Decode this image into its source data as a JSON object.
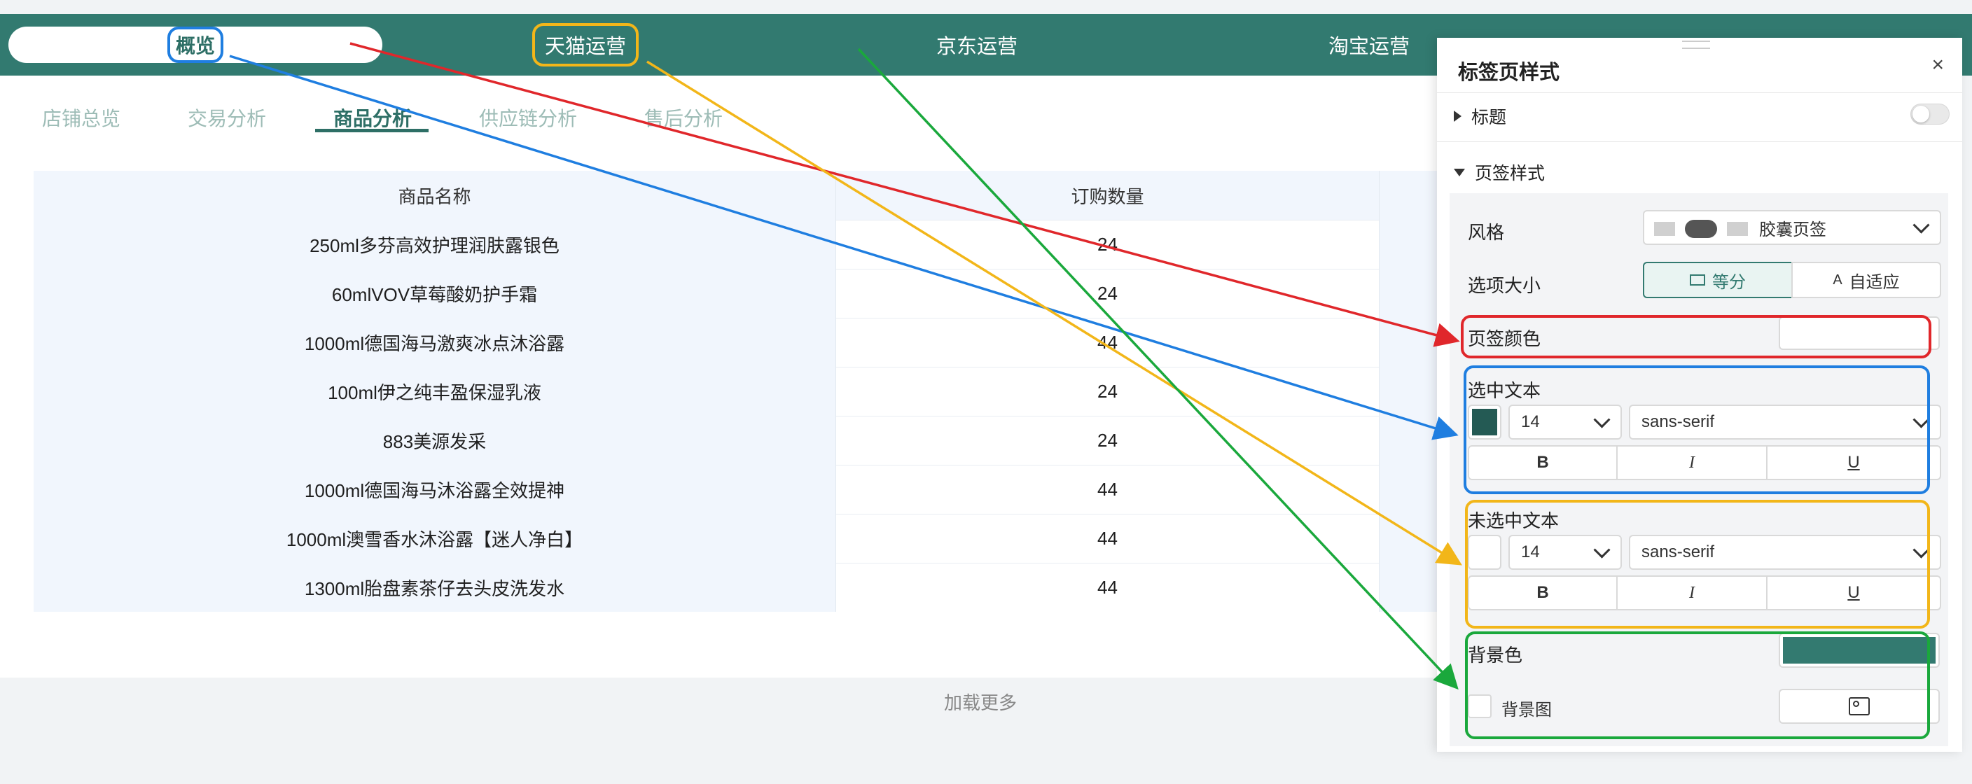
{
  "top_tabs": [
    {
      "label": "概览"
    },
    {
      "label": "天猫运营"
    },
    {
      "label": "京东运营"
    },
    {
      "label": "淘宝运营"
    }
  ],
  "sub_tabs": [
    {
      "label": "店铺总览"
    },
    {
      "label": "交易分析"
    },
    {
      "label": "商品分析"
    },
    {
      "label": "供应链分析"
    },
    {
      "label": "售后分析"
    }
  ],
  "table": {
    "headers": [
      "商品名称",
      "订购数量"
    ],
    "rows": [
      [
        "250ml多芬高效护理润肤露银色",
        "24"
      ],
      [
        "60mlVOV草莓酸奶护手霜",
        "24"
      ],
      [
        "1000ml德国海马激爽冰点沐浴露",
        "44"
      ],
      [
        "100ml伊之纯丰盈保湿乳液",
        "24"
      ],
      [
        "883美源发采",
        "24"
      ],
      [
        "1000ml德国海马沐浴露全效提神",
        "44"
      ],
      [
        "1000ml澳雪香水沐浴露【迷人净白】",
        "44"
      ],
      [
        "1300ml胎盘素茶仔去头皮洗发水",
        "44"
      ]
    ],
    "load_more": "加载更多"
  },
  "panel": {
    "title": "标签页样式",
    "close": "×",
    "title_section": "标题",
    "tab_style_section": "页签样式",
    "style_label": "风格",
    "style_value": "胶囊页签",
    "size_label": "选项大小",
    "size_options": [
      "等分",
      "自适应"
    ],
    "tab_color_label": "页签颜色",
    "selected_text_label": "选中文本",
    "selected_font_size": "14",
    "selected_font_family": "sans-serif",
    "unselected_text_label": "未选中文本",
    "unselected_font_size": "14",
    "unselected_font_family": "sans-serif",
    "bold": "B",
    "italic": "I",
    "underline": "U",
    "bg_color_label": "背景色",
    "bg_image_label": "背景图"
  },
  "colors": {
    "brand": "#327a70",
    "selected_swatch": "#245a54",
    "bg_swatch": "#337a70",
    "red": "#e0272b",
    "blue": "#1f7ee0",
    "yellow": "#f2b619",
    "green": "#1aa83c"
  }
}
